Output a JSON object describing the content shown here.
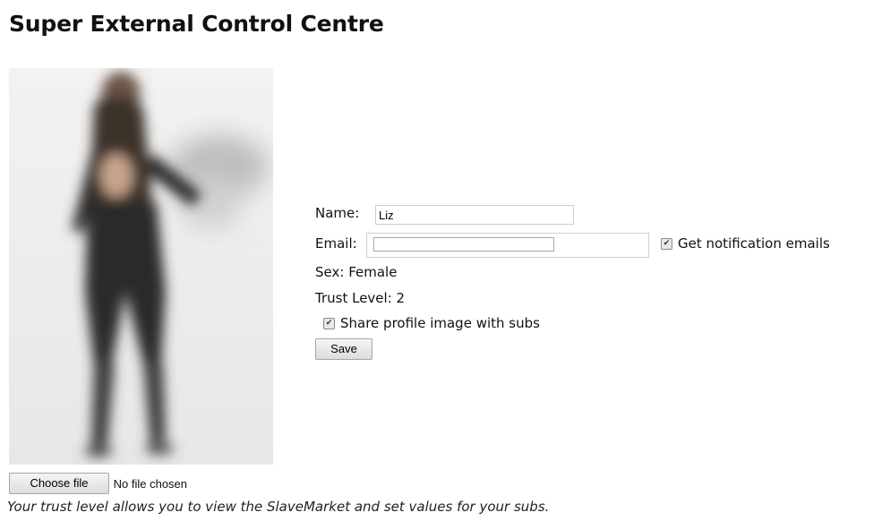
{
  "page": {
    "title": "Super External Control Centre"
  },
  "profile": {
    "name_label": "Name:",
    "name_value": "Liz",
    "email_label": "Email:",
    "notification_label": "Get notification emails",
    "notification_checked": true,
    "sex_label": "Sex:",
    "sex_value": "Female",
    "trust_label": "Trust Level:",
    "trust_value": "2",
    "share_label": "Share profile image with subs",
    "share_checked": true,
    "save_label": "Save"
  },
  "file_upload": {
    "button_label": "Choose file",
    "status": "No file chosen"
  },
  "footer_note": "Your trust level allows you to view the SlaveMarket and set values for your subs.",
  "icons": {
    "checkbox_checked": "checkmark-icon"
  }
}
